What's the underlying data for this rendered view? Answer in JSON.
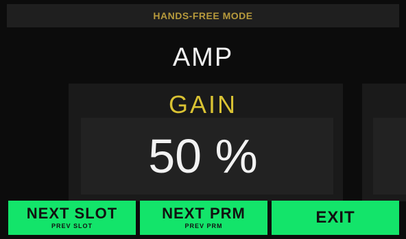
{
  "header": {
    "title": "HANDS-FREE MODE"
  },
  "main": {
    "block_name": "AMP",
    "parameter_name": "GAIN",
    "parameter_value": "50 %"
  },
  "footer": {
    "buttons": [
      {
        "label": "NEXT SLOT",
        "sub_label": "PREV SLOT"
      },
      {
        "label": "NEXT PRM",
        "sub_label": "PREV PRM"
      },
      {
        "label": "EXIT",
        "sub_label": ""
      }
    ]
  },
  "colors": {
    "background": "#0c0c0c",
    "title_text": "#b79a3c",
    "param_name": "#d9c233",
    "value_text": "#f2f2f2",
    "button_green": "#13e46a"
  }
}
